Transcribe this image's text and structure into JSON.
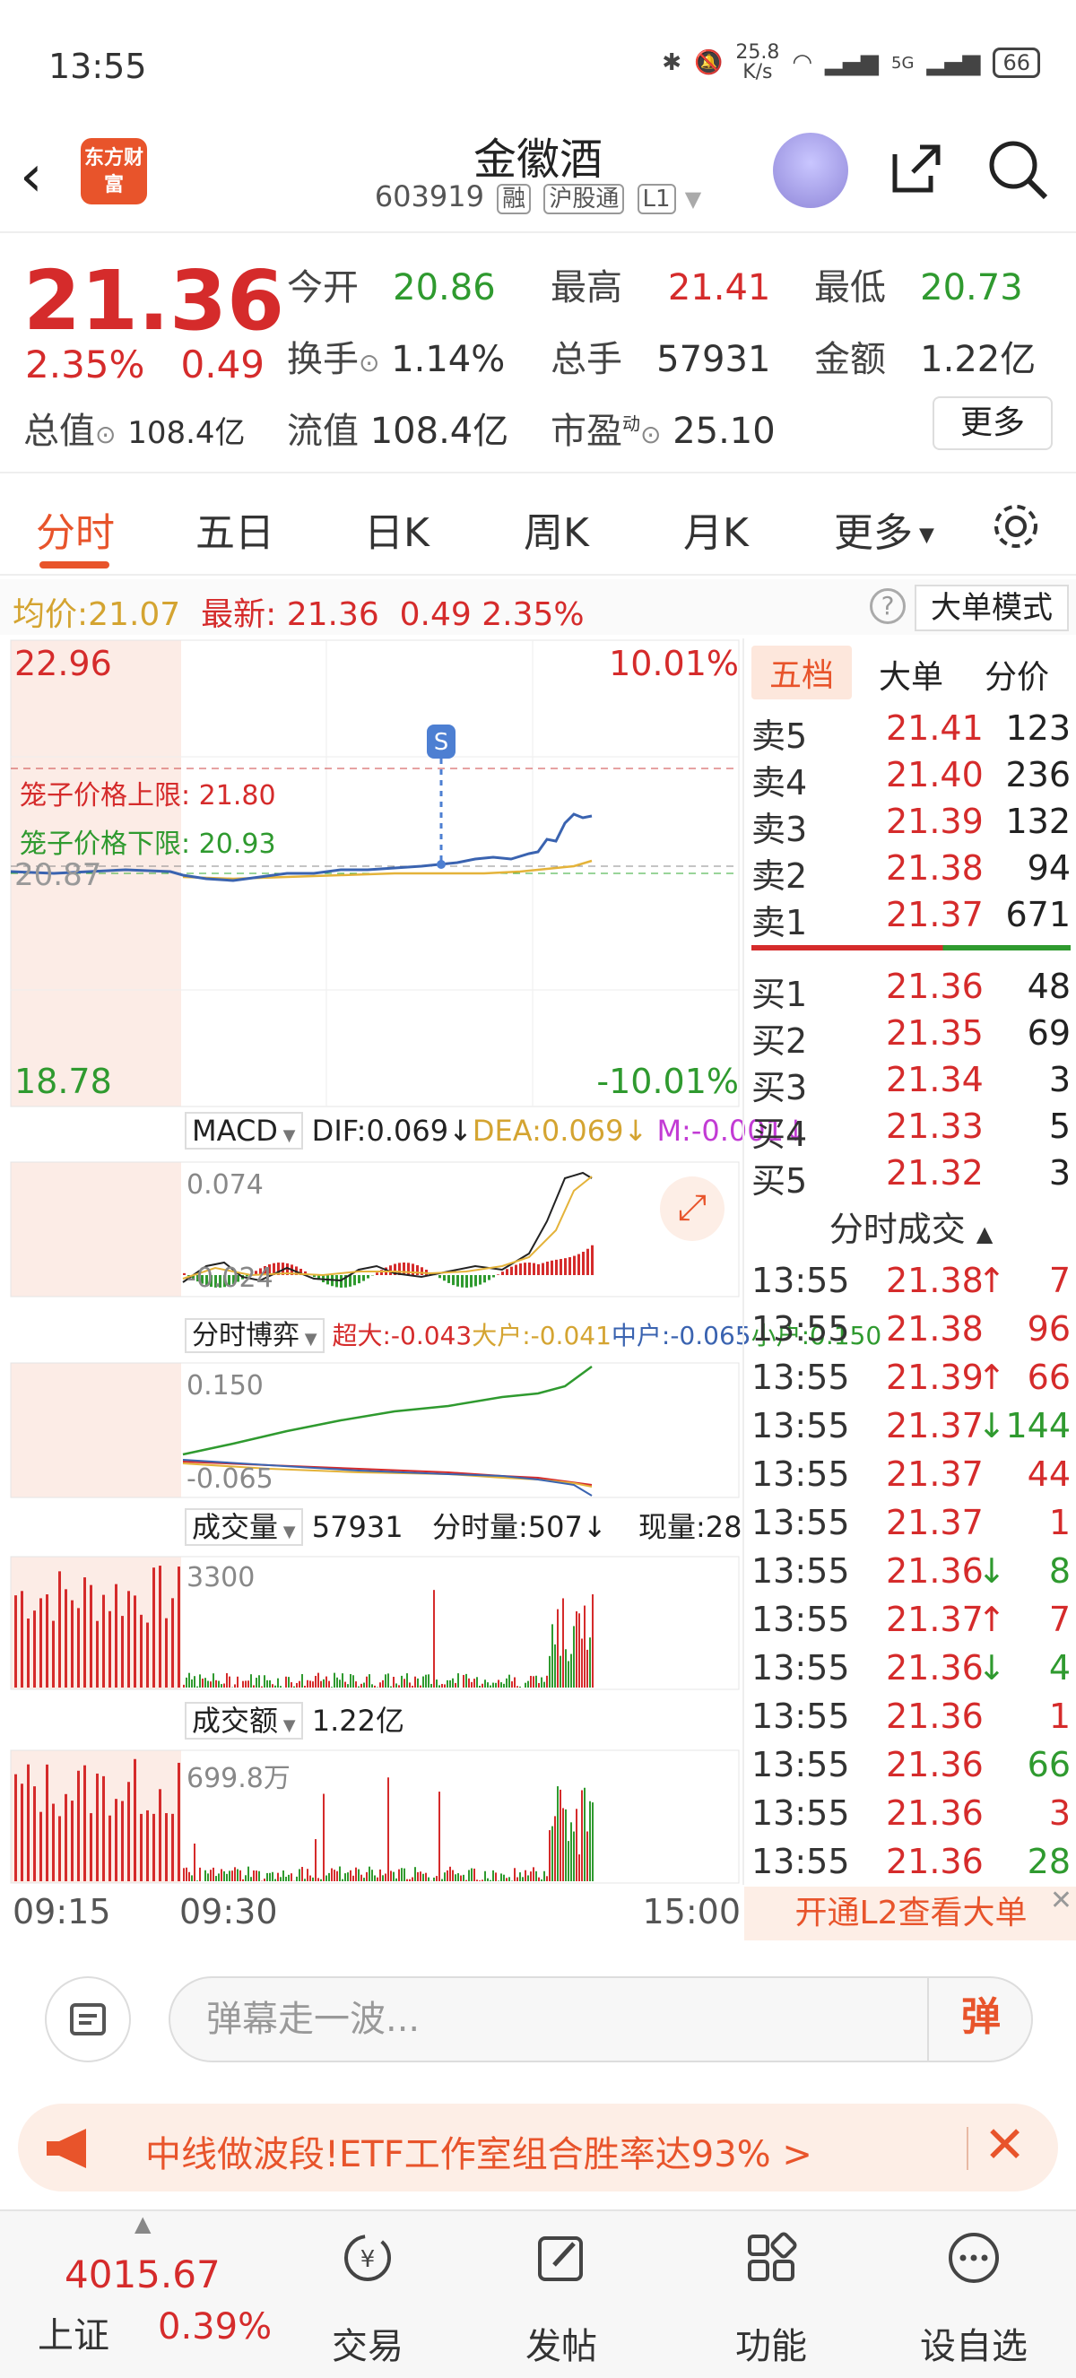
{
  "status": {
    "time": "13:55",
    "speed": "25.8\nK/s",
    "network": "5G",
    "battery": "66"
  },
  "header": {
    "name": "金徽酒",
    "code": "603919",
    "tags": [
      "融",
      "沪股通",
      "L1"
    ],
    "logo_text": "东方财富"
  },
  "quote": {
    "price": "21.36",
    "pct": "2.35%",
    "chg": "0.49",
    "rows": [
      [
        {
          "k": "今开",
          "v": "20.86",
          "c": "green"
        },
        {
          "k": "最高",
          "v": "21.41",
          "c": "red"
        },
        {
          "k": "最低",
          "v": "20.73",
          "c": "green"
        }
      ],
      [
        {
          "k": "换手",
          "v": "1.14%",
          "c": "dark"
        },
        {
          "k": "总手",
          "v": "57931",
          "c": "dark"
        },
        {
          "k": "金额",
          "v": "1.22亿",
          "c": "dark"
        }
      ]
    ],
    "row3": [
      {
        "k": "总值",
        "v": "108.4亿"
      },
      {
        "k": "流值",
        "v": "108.4亿"
      },
      {
        "k": "市盈",
        "sup": "动",
        "v": "25.10"
      }
    ],
    "more": "更多"
  },
  "tabs": [
    "分时",
    "五日",
    "日K",
    "周K",
    "月K",
    "更多"
  ],
  "avgbar": {
    "avg_label": "均价:",
    "avg": "21.07",
    "latest_label": "最新:",
    "latest": "21.36",
    "chg": "0.49",
    "pct": "2.35%",
    "mode": "大单模式"
  },
  "main_chart": {
    "ymax": "22.96",
    "ymin": "18.78",
    "pct_max": "10.01%",
    "pct_min": "-10.01%",
    "prev_close": "20.87",
    "upper_label": "笼子价格上限: 21.80",
    "lower_label": "笼子价格下限: 20.93",
    "marker": "S"
  },
  "macd": {
    "name": "MACD",
    "dif": "DIF:0.069↓",
    "dea": "DEA:0.069↓",
    "m": "M:-0.001↓",
    "top": "0.074",
    "bot": "-0.024"
  },
  "flow": {
    "name": "分时博弈",
    "super": "超大:-0.043",
    "large": "大户:-0.041",
    "mid": "中户:-0.065",
    "small": "小户:0.150",
    "top": "0.150",
    "bot": "-0.065"
  },
  "volume": {
    "name": "成交量",
    "total": "57931",
    "minute": "分时量:507↓",
    "now": "现量:28",
    "top": "3300"
  },
  "amount": {
    "name": "成交额",
    "total": "1.22亿",
    "top": "699.8万"
  },
  "time_axis": [
    "09:15",
    "09:30",
    "15:00"
  ],
  "book": {
    "tabs": [
      "五档",
      "大单",
      "分价"
    ],
    "asks": [
      [
        "卖5",
        "21.41",
        "123"
      ],
      [
        "卖4",
        "21.40",
        "236"
      ],
      [
        "卖3",
        "21.39",
        "132"
      ],
      [
        "卖2",
        "21.38",
        "94"
      ],
      [
        "卖1",
        "21.37",
        "671"
      ]
    ],
    "bids": [
      [
        "买1",
        "21.36",
        "48"
      ],
      [
        "买2",
        "21.35",
        "69"
      ],
      [
        "买3",
        "21.34",
        "3"
      ],
      [
        "买4",
        "21.33",
        "5"
      ],
      [
        "买5",
        "21.32",
        "3"
      ]
    ],
    "trades_title": "分时成交",
    "trades": [
      [
        "13:55",
        "21.38",
        "↑",
        "7",
        "red"
      ],
      [
        "13:55",
        "21.38",
        "",
        "96",
        "red"
      ],
      [
        "13:55",
        "21.39",
        "↑",
        "66",
        "red"
      ],
      [
        "13:55",
        "21.37",
        "↓",
        "144",
        "green"
      ],
      [
        "13:55",
        "21.37",
        "",
        "44",
        "red"
      ],
      [
        "13:55",
        "21.37",
        "",
        "1",
        "red"
      ],
      [
        "13:55",
        "21.36",
        "↓",
        "8",
        "green"
      ],
      [
        "13:55",
        "21.37",
        "↑",
        "7",
        "red"
      ],
      [
        "13:55",
        "21.36",
        "↓",
        "4",
        "green"
      ],
      [
        "13:55",
        "21.36",
        "",
        "1",
        "red"
      ],
      [
        "13:55",
        "21.36",
        "",
        "66",
        "green"
      ],
      [
        "13:55",
        "21.36",
        "",
        "3",
        "red"
      ],
      [
        "13:55",
        "21.36",
        "",
        "28",
        "green"
      ]
    ],
    "l2": "开通L2查看大单"
  },
  "comment": {
    "placeholder": "弹幕走一波...",
    "dan": "弹"
  },
  "promo": {
    "text": "中线做波段!ETF工作室组合胜率达93% >"
  },
  "bottom": {
    "index_value": "4015.67",
    "index_name": "上证",
    "index_pct": "0.39%",
    "items": [
      "交易",
      "发帖",
      "功能",
      "设自选"
    ]
  }
}
